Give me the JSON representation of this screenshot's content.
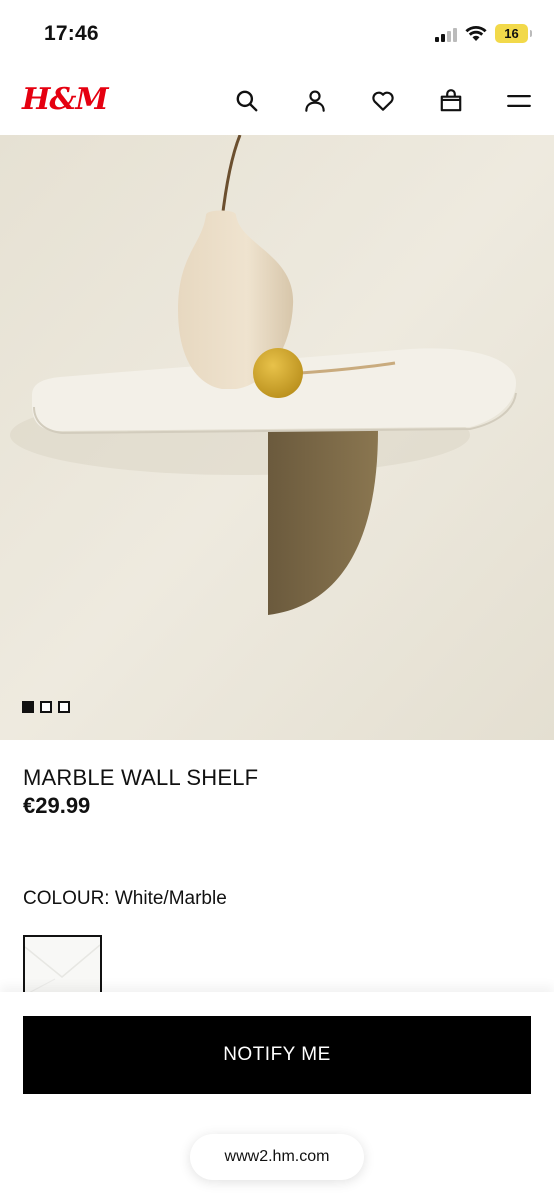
{
  "status_bar": {
    "time": "17:46",
    "battery": "16",
    "signal_bars": 2,
    "signal_total": 4,
    "battery_color": "#f2d94a"
  },
  "header": {
    "logo": "H&M",
    "brand_color": "#e50010",
    "icons": [
      "search-icon",
      "account-icon",
      "favourites-icon",
      "bag-icon",
      "menu-icon"
    ]
  },
  "gallery": {
    "image_count": 3,
    "active_index": 0
  },
  "product": {
    "title": "MARBLE WALL SHELF",
    "price": "€29.99",
    "colour_label": "COLOUR:",
    "colour_value": "White/Marble",
    "colour_text": "COLOUR: White/Marble"
  },
  "actions": {
    "notify_label": "NOTIFY ME"
  },
  "browser": {
    "url": "www2.hm.com"
  }
}
